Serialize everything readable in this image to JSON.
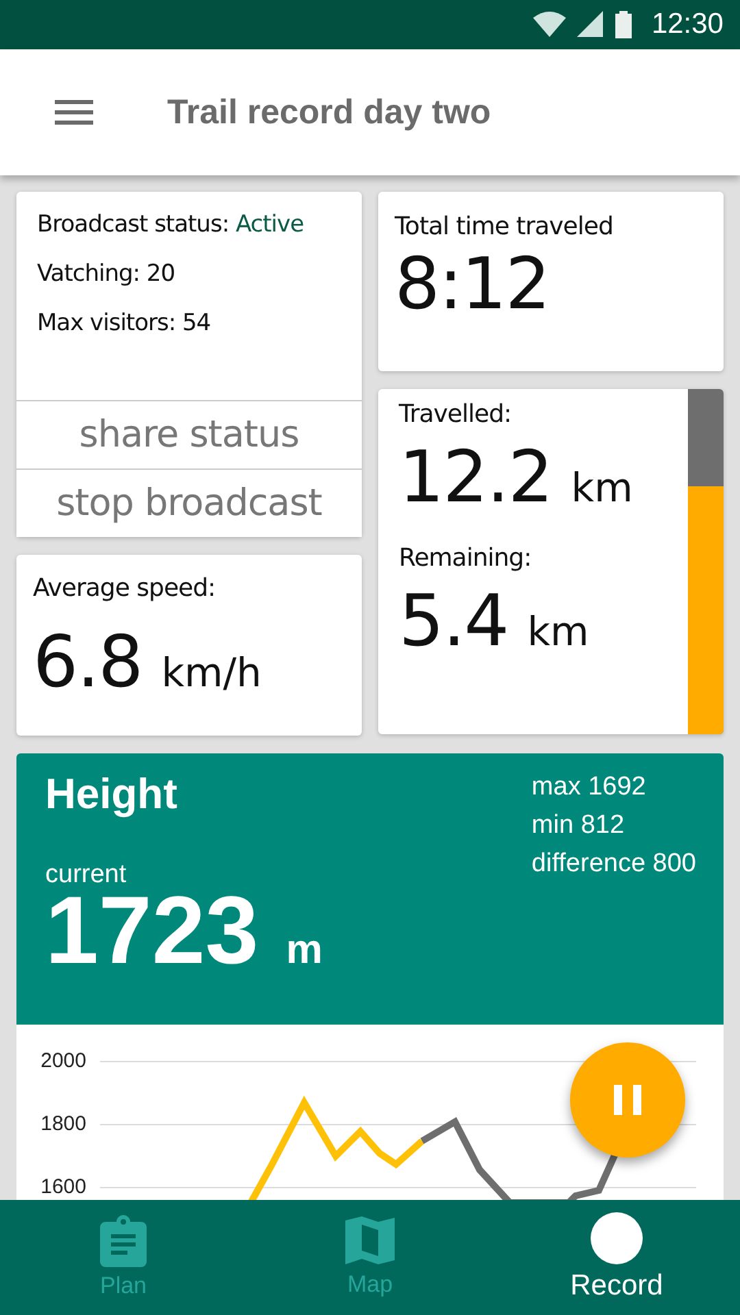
{
  "status_bar": {
    "time": "12:30"
  },
  "app_bar": {
    "title": "Trail record day two"
  },
  "broadcast": {
    "status_label": "Broadcast status:",
    "status_value": "Active",
    "watching": "Vatching: 20",
    "max_visitors": "Max visitors: 54",
    "actions": [
      "share status",
      "stop broadcast"
    ]
  },
  "total_time": {
    "label": "Total time traveled",
    "value": "8:12"
  },
  "distance": {
    "travelled_label": "Travelled:",
    "travelled_value": "12.2",
    "travelled_unit": "km",
    "remaining_label": "Remaining:",
    "remaining_value": "5.4",
    "remaining_unit": "km",
    "level": 0.72
  },
  "average_speed": {
    "label": "Average speed:",
    "value": "6.8",
    "unit": "km/h"
  },
  "height": {
    "title": "Height",
    "stats": [
      "max 1692",
      "min 812",
      "difference 800"
    ],
    "current_label": "current",
    "current_value": "1723",
    "unit": "m",
    "chart": {
      "axis_labels": [
        "2000",
        "1800",
        "1600"
      ]
    }
  },
  "fab": {
    "kind": "pause"
  },
  "tabs": [
    {
      "label": "Plan",
      "kind": "plan",
      "selected": false
    },
    {
      "label": "Map",
      "kind": "map",
      "selected": false
    },
    {
      "label": "Record",
      "kind": "record",
      "selected": true
    }
  ]
}
